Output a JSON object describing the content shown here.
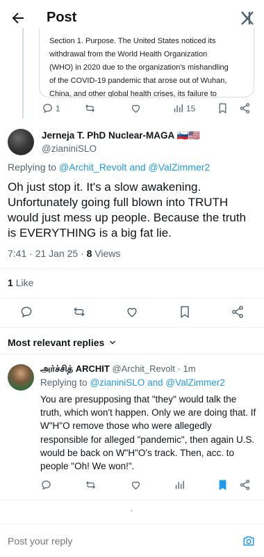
{
  "header": {
    "title": "Post",
    "back_icon": "arrow-left-icon",
    "logo_icon": "x-logo-icon"
  },
  "quoted": {
    "lines": [
      "Section 1.  Purpose.  The United States noticed its",
      "withdrawal from the World Health Organization",
      "(WHO) in 2020 due to the organization's mishandling",
      "of the COVID-19 pandemic that arose out of Wuhan,",
      "China, and other global health crises, its failure to"
    ],
    "actions": {
      "replies": "1",
      "views": "15"
    }
  },
  "main_post": {
    "name": "Jerneja T. PhD Nuclear-MAGA 🇸🇮🇺🇸",
    "handle": "@ziani niSLO",
    "handle_display": "@zianiniSLO",
    "replying_prefix": "Replying to",
    "replying_to_1": "@Archit_Revolt",
    "replying_and": "and",
    "replying_to_2": "@ValZimmer2",
    "text": "Oh just stop it. It's a slow awakening. Unfortunately going full blown into TRUTH would just mess up people. Because the truth is EVERYTHING is a big fat lie.",
    "timestamp": "7:41 · 21 Jan 25 ·",
    "views_count": "8",
    "views_label": "Views",
    "likes_count": "1",
    "likes_label": "Like"
  },
  "replies_sort": {
    "label": "Most relevant replies"
  },
  "reply": {
    "name": "அர்ச்சித் ARCHIT",
    "handle_time": "@Archit_Revolt · 1m",
    "replying_prefix": "Replying to",
    "replying_to_1": "@zianiniSLO",
    "replying_and": "and",
    "replying_to_2": "@ValZimmer2",
    "text": "You are presupposing that \"they\" would talk the truth, which won't happen. Only we are doing that. If W\"H\"O remove those who were allegedly responsible for alleged \"pandemic\", then again U.S. would be back on W\"H\"O's track. Then, acc. to people \"Oh! We won!\"."
  },
  "compose": {
    "placeholder": "Post your reply"
  },
  "colors": {
    "link": "#1d9bf0",
    "muted": "#536471",
    "text": "#0f1419",
    "bookmark_active": "#1d9bf0"
  }
}
